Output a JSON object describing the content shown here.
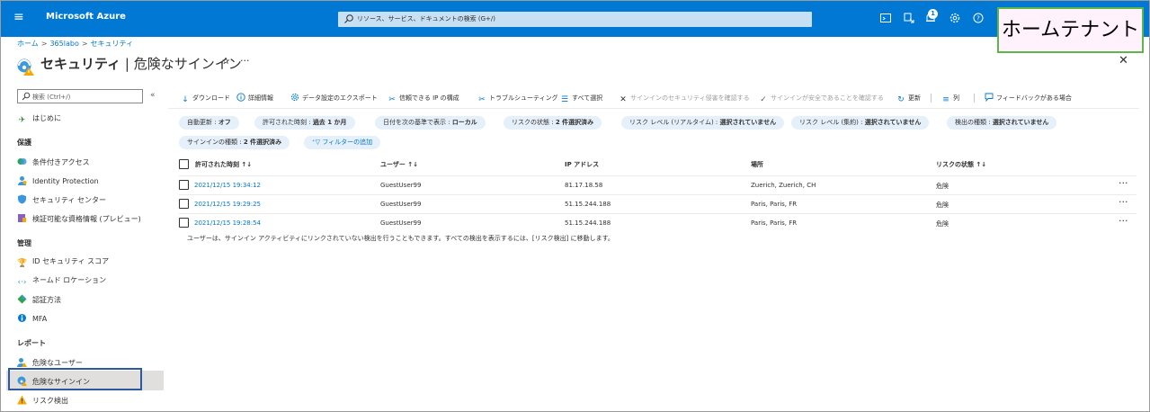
{
  "topbar": {
    "brand": "Microsoft Azure",
    "search_placeholder": "リソース、サービス、ドキュメントの検索 (G+/)",
    "notification_count": "1"
  },
  "overlay": {
    "home_tenant_label": "ホームテナント"
  },
  "breadcrumb": [
    "ホーム",
    "365labo",
    "セキュリティ"
  ],
  "title": {
    "bold": "セキュリティ",
    "sep": " | ",
    "rest": "危険なサインイン"
  },
  "sidebar": {
    "search_placeholder": "検索 (Ctrl+/)",
    "collapse": "«",
    "intro": "はじめに",
    "sections": [
      {
        "header": "保護",
        "items": [
          "条件付きアクセス",
          "Identity Protection",
          "セキュリティ センター",
          "検証可能な資格情報 (プレビュー)"
        ]
      },
      {
        "header": "管理",
        "items": [
          "ID セキュリティ スコア",
          "ネームド ロケーション",
          "認証方法",
          "MFA"
        ]
      },
      {
        "header": "レポート",
        "items": [
          "危険なユーザー",
          "危険なサインイン",
          "リスク検出"
        ]
      }
    ]
  },
  "toolbar": {
    "download": "ダウンロード",
    "details": "詳細情報",
    "export": "データ設定のエクスポート",
    "trusted_ip": "信頼できる IP の構成",
    "troubleshoot": "トラブルシューティング",
    "select_all": "すべて選択",
    "confirm_compromised": "サインインのセキュリティ侵害を確認する",
    "confirm_safe": "サインインが安全であることを確認する",
    "refresh": "更新",
    "columns": "列",
    "feedback": "フィードバックがある場合"
  },
  "filters": [
    {
      "label": "自動更新 : ",
      "value": "オフ"
    },
    {
      "label": "許可された時刻 : ",
      "value": "過去 1 か月"
    },
    {
      "label": "日付を次の基準で表示 : ",
      "value": "ローカル"
    },
    {
      "label": "リスクの状態 : ",
      "value": "2 件選択済み"
    },
    {
      "label": "リスク レベル (リアルタイム) : ",
      "value": "選択されていません"
    },
    {
      "label": "リスク レベル (集約) : ",
      "value": "選択されていません"
    },
    {
      "label": "検出の種類 : ",
      "value": "選択されていません"
    },
    {
      "label": "サインインの種類 : ",
      "value": "2 件選択済み"
    }
  ],
  "add_filter": "フィルターの追加",
  "table": {
    "headers": [
      "許可された時刻 ↑↓",
      "ユーザー ↑↓",
      "IP アドレス",
      "場所",
      "リスクの状態 ↑↓"
    ],
    "rows": [
      {
        "time": "2021/12/15 19:34:12",
        "user": "GuestUser99",
        "ip": "81.17.18.58",
        "location": "Zuerich, Zuerich, CH",
        "risk": "危険"
      },
      {
        "time": "2021/12/15 19:29:25",
        "user": "GuestUser99",
        "ip": "51.15.244.188",
        "location": "Paris, Paris, FR",
        "risk": "危険"
      },
      {
        "time": "2021/12/15 19:28:54",
        "user": "GuestUser99",
        "ip": "51.15.244.188",
        "location": "Paris, Paris, FR",
        "risk": "危険"
      }
    ],
    "row_more": "···",
    "footnote": "ユーザーは、サインイン アクティビティにリンクされていない検出を行うこともできます。すべての検出を表示するには、[リスク検出] に移動します。"
  },
  "colors": {
    "azure_blue": "#0078d4",
    "pill_bg": "#e6f0fa",
    "warning": "#f7a700"
  }
}
